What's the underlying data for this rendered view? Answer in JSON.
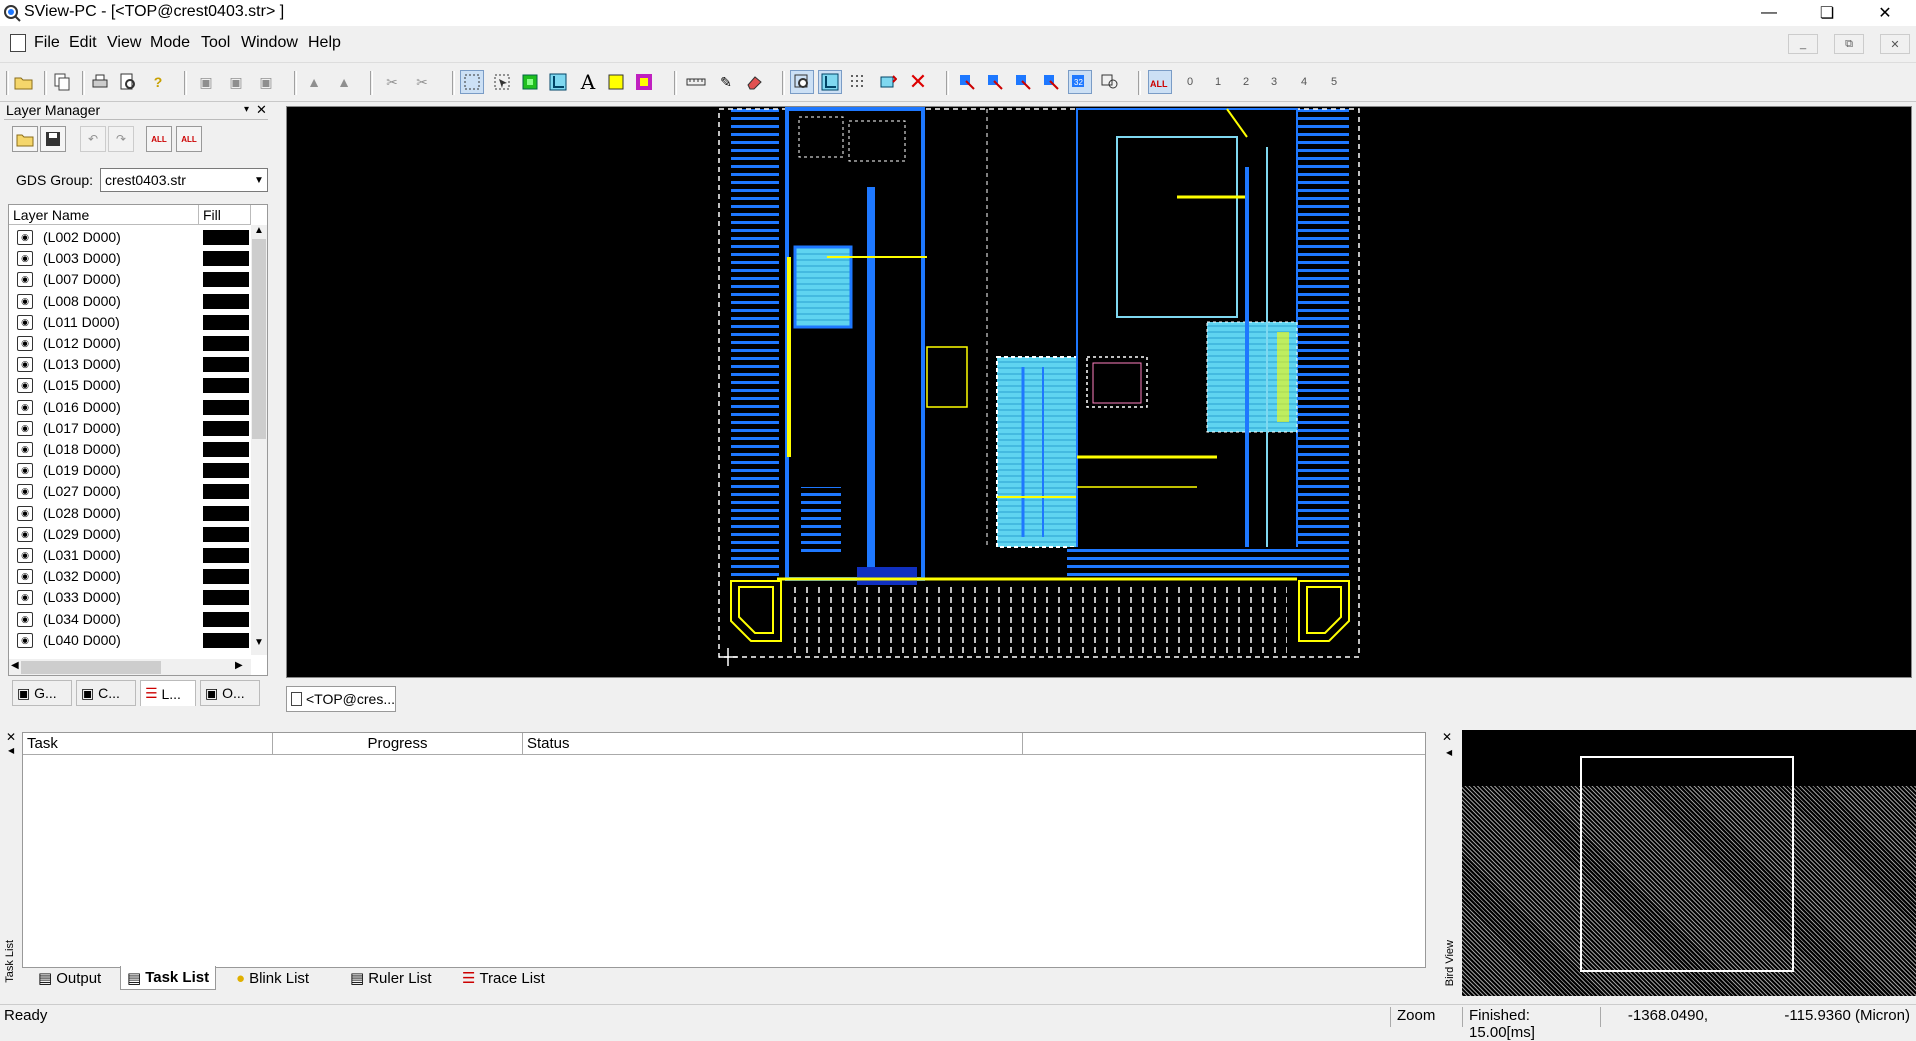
{
  "window": {
    "title": "SView-PC - [<TOP@crest0403.str> ]",
    "controls": [
      "minimize",
      "restore",
      "close"
    ]
  },
  "menu": [
    "File",
    "Edit",
    "View",
    "Mode",
    "Tool",
    "Window",
    "Help"
  ],
  "layer_manager": {
    "title": "Layer Manager",
    "gds_group_label": "GDS Group:",
    "gds_group_value": "crest0403.str",
    "columns": {
      "name": "Layer Name",
      "fill": "Fill"
    },
    "layers": [
      "(L002 D000)",
      "(L003 D000)",
      "(L007 D000)",
      "(L008 D000)",
      "(L011 D000)",
      "(L012 D000)",
      "(L013 D000)",
      "(L015 D000)",
      "(L016 D000)",
      "(L017 D000)",
      "(L018 D000)",
      "(L019 D000)",
      "(L027 D000)",
      "(L028 D000)",
      "(L029 D000)",
      "(L031 D000)",
      "(L032 D000)",
      "(L033 D000)",
      "(L034 D000)",
      "(L040 D000)"
    ],
    "tabs": [
      "G...",
      "C...",
      "L...",
      "O..."
    ],
    "selected_tab": "L..."
  },
  "document_tab": "<TOP@cres...",
  "task_list": {
    "side_label": "Task List",
    "columns": [
      "Task",
      "Progress",
      "Status"
    ],
    "tabs": [
      "Output",
      "Task List",
      "Blink List",
      "Ruler List",
      "Trace List"
    ],
    "selected_tab": "Task List"
  },
  "bird_view": {
    "side_label": "Bird View"
  },
  "status": {
    "left": "Ready",
    "mode": "Zoom",
    "timing": "Finished: 15.00[ms]",
    "x": "-1368.0490,",
    "y": "-115.9360 (Micron)"
  },
  "colors": {
    "canvas_bg": "#000000",
    "layout_blue": "#1e78ff",
    "layout_cyan": "#7fd8f0",
    "layout_yellow": "#ffff00",
    "layout_white": "#ffffff"
  }
}
